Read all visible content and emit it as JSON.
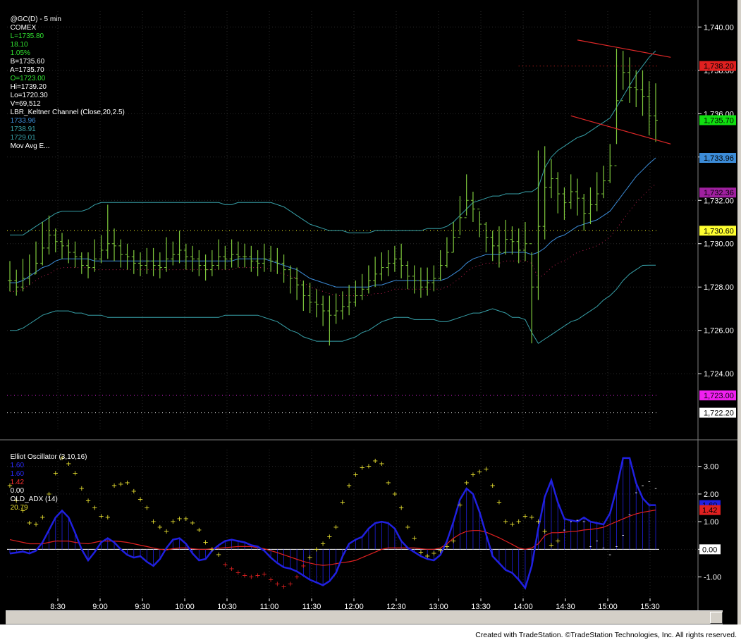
{
  "header": {
    "symbol": "@GC(D) - 5 min",
    "exchange": "COMEX",
    "last": "L=1735.80",
    "change": "18.10",
    "change_pct": "1.05%",
    "bid": "B=1735.60",
    "ask": "A=1735.70",
    "open": "O=1723.00",
    "high": "Hi=1739.20",
    "low": "Lo=1720.30",
    "volume": "V=69,512",
    "indicator": "LBR_Keltner Channel (Close,20,2.5)",
    "kc_mid": "1733.96",
    "kc_upper": "1738.91",
    "kc_lower": "1729.01",
    "mov_avg": "Mov Avg E..."
  },
  "osc_header": {
    "name": "Elliot Oscillator (3,10,16)",
    "v1": "1.60",
    "v2": "1.60",
    "v3": "1.42",
    "v4": "0.00",
    "adx_name": "OLD_ADX (14)",
    "adx_value": "20.79"
  },
  "footer": "Created with TradeStation. ©TradeStation Technologies, Inc. All rights reserved.",
  "colors": {
    "bar": "#7ec83c",
    "kc_band": "#37a0a8",
    "kc_mid": "#3c8cd8",
    "trend": "#e02828",
    "osc_line": "#2020e0",
    "osc_sig": "#e02020",
    "adx_dot": "#e8e030",
    "grid": "#2a2a2a"
  },
  "chart_data": [
    {
      "type": "candlestick",
      "title": "@GC(D) - 5 min",
      "x_ticks": [
        "8:30",
        "9:00",
        "9:30",
        "10:00",
        "10:30",
        "11:00",
        "11:30",
        "12:00",
        "12:30",
        "13:00",
        "13:30",
        "14:00",
        "14:30",
        "15:00",
        "15:30"
      ],
      "y_ticks": [
        "1,740.00",
        "1,738.00",
        "1,736.00",
        "1,734.00",
        "1,732.00",
        "1,730.00",
        "1,728.00",
        "1,726.00",
        "1,724.00"
      ],
      "ylim": [
        1721.6,
        1740.4
      ],
      "price_labels": [
        {
          "text": "1,738.20",
          "value": 1738.2,
          "bg": "#e02020",
          "fg": "#000000"
        },
        {
          "text": "1,735.70",
          "value": 1735.7,
          "bg": "#10e010",
          "fg": "#000000"
        },
        {
          "text": "1,733.96",
          "value": 1733.96,
          "bg": "#3c8cd8",
          "fg": "#000000"
        },
        {
          "text": "1,732.36",
          "value": 1732.36,
          "bg": "#a020a0",
          "fg": "#000000"
        },
        {
          "text": "1,730.60",
          "value": 1730.6,
          "bg": "#ffff30",
          "fg": "#000000"
        },
        {
          "text": "1,723.00",
          "value": 1723.0,
          "bg": "#f020f0",
          "fg": "#000000"
        },
        {
          "text": "1,722.20",
          "value": 1722.2,
          "bg": "#ffffff",
          "fg": "#000000"
        }
      ],
      "closes": [
        1728.3,
        1728.0,
        1728.4,
        1728.6,
        1729.1,
        1729.8,
        1730.4,
        1730.1,
        1729.9,
        1729.6,
        1729.4,
        1729.0,
        1728.9,
        1729.3,
        1729.7,
        1730.0,
        1729.9,
        1729.5,
        1729.4,
        1729.1,
        1729.0,
        1729.2,
        1729.0,
        1728.9,
        1729.3,
        1729.5,
        1729.7,
        1729.4,
        1729.3,
        1729.0,
        1728.8,
        1729.0,
        1729.4,
        1729.3,
        1729.5,
        1729.4,
        1729.4,
        1729.2,
        1729.1,
        1729.3,
        1729.2,
        1729.1,
        1728.8,
        1728.4,
        1728.1,
        1727.6,
        1727.3,
        1727.2,
        1726.9,
        1726.7,
        1726.9,
        1727.1,
        1727.3,
        1727.6,
        1727.9,
        1728.3,
        1728.6,
        1728.9,
        1729.1,
        1729.3,
        1729.0,
        1728.5,
        1728.3,
        1728.0,
        1728.2,
        1728.4,
        1729.0,
        1729.6,
        1730.3,
        1731.2,
        1732.0,
        1731.6,
        1730.9,
        1730.3,
        1729.9,
        1729.6,
        1730.2,
        1730.1,
        1729.7,
        1730.0,
        1728.0,
        1730.8,
        1732.6,
        1733.0,
        1732.3,
        1731.9,
        1732.4,
        1732.1,
        1731.4,
        1731.8,
        1732.3,
        1732.9,
        1733.6,
        1736.6,
        1737.9,
        1737.2,
        1737.1,
        1736.8,
        1735.9,
        1735.7
      ],
      "highs": [
        1729.2,
        1728.8,
        1729.3,
        1729.5,
        1730.1,
        1731.0,
        1731.3,
        1730.7,
        1730.5,
        1730.2,
        1730.1,
        1729.6,
        1729.6,
        1730.2,
        1730.4,
        1731.8,
        1730.7,
        1730.2,
        1730.0,
        1729.7,
        1729.6,
        1729.8,
        1729.8,
        1729.6,
        1730.3,
        1730.1,
        1730.6,
        1730.0,
        1729.9,
        1729.7,
        1729.5,
        1729.7,
        1730.2,
        1729.9,
        1730.2,
        1730.1,
        1730.0,
        1729.9,
        1729.7,
        1730.0,
        1729.9,
        1729.8,
        1729.5,
        1729.0,
        1728.9,
        1728.3,
        1728.2,
        1727.9,
        1727.6,
        1727.6,
        1727.7,
        1727.8,
        1728.1,
        1728.3,
        1728.6,
        1729.0,
        1729.4,
        1729.6,
        1729.7,
        1729.9,
        1730.0,
        1729.2,
        1729.0,
        1728.9,
        1728.9,
        1729.0,
        1729.7,
        1730.3,
        1731.0,
        1732.2,
        1733.2,
        1732.4,
        1731.5,
        1731.0,
        1730.6,
        1730.8,
        1731.1,
        1730.8,
        1730.7,
        1731.0,
        1729.6,
        1734.3,
        1734.5,
        1733.9,
        1733.3,
        1732.6,
        1733.2,
        1733.0,
        1732.3,
        1732.6,
        1733.3,
        1733.6,
        1734.6,
        1739.0,
        1738.9,
        1738.6,
        1738.0,
        1738.0,
        1737.5,
        1737.4
      ],
      "lows": [
        1727.8,
        1727.6,
        1727.8,
        1728.1,
        1728.6,
        1729.0,
        1729.5,
        1729.6,
        1729.3,
        1729.1,
        1728.9,
        1728.6,
        1728.4,
        1728.7,
        1729.1,
        1729.3,
        1729.2,
        1728.9,
        1728.8,
        1728.6,
        1728.5,
        1728.6,
        1728.5,
        1728.4,
        1728.7,
        1729.0,
        1729.1,
        1728.8,
        1728.7,
        1728.5,
        1728.3,
        1728.5,
        1728.8,
        1728.8,
        1728.9,
        1728.9,
        1728.9,
        1728.7,
        1728.5,
        1728.7,
        1728.7,
        1728.6,
        1728.2,
        1727.7,
        1727.4,
        1726.9,
        1726.8,
        1726.6,
        1726.2,
        1725.3,
        1726.3,
        1726.5,
        1726.7,
        1727.1,
        1727.4,
        1727.7,
        1728.0,
        1728.3,
        1728.5,
        1728.7,
        1728.4,
        1727.9,
        1727.7,
        1727.5,
        1727.6,
        1727.8,
        1728.3,
        1728.9,
        1729.6,
        1730.4,
        1731.3,
        1731.0,
        1730.3,
        1729.6,
        1729.2,
        1728.9,
        1729.5,
        1729.5,
        1729.1,
        1729.2,
        1725.4,
        1727.4,
        1730.2,
        1732.1,
        1731.4,
        1731.1,
        1731.6,
        1731.3,
        1730.6,
        1730.9,
        1731.5,
        1732.1,
        1732.8,
        1734.6,
        1737.1,
        1736.5,
        1736.3,
        1735.9,
        1735.0,
        1734.7
      ],
      "kc_mid_line": [
        1728.2,
        1728.2,
        1728.3,
        1728.5,
        1728.7,
        1728.9,
        1729.0,
        1729.2,
        1729.3,
        1729.3,
        1729.3,
        1729.3,
        1729.3,
        1729.2,
        1729.2,
        1729.2,
        1729.2,
        1729.2,
        1729.2,
        1729.2,
        1729.2,
        1729.2,
        1729.2,
        1729.2,
        1729.2,
        1729.2,
        1729.2,
        1729.2,
        1729.2,
        1729.2,
        1729.2,
        1729.2,
        1729.2,
        1729.2,
        1729.2,
        1729.3,
        1729.3,
        1729.3,
        1729.3,
        1729.3,
        1729.2,
        1729.1,
        1729.0,
        1728.9,
        1728.8,
        1728.6,
        1728.4,
        1728.3,
        1728.2,
        1728.1,
        1728.0,
        1728.0,
        1728.0,
        1728.0,
        1728.0,
        1728.0,
        1728.1,
        1728.1,
        1728.2,
        1728.3,
        1728.3,
        1728.3,
        1728.3,
        1728.3,
        1728.3,
        1728.3,
        1728.3,
        1728.4,
        1728.6,
        1728.8,
        1729.1,
        1729.3,
        1729.4,
        1729.5,
        1729.5,
        1729.5,
        1729.6,
        1729.6,
        1729.6,
        1729.6,
        1729.5,
        1729.6,
        1729.8,
        1730.1,
        1730.3,
        1730.4,
        1730.6,
        1730.8,
        1730.9,
        1731.0,
        1731.1,
        1731.3,
        1731.5,
        1731.9,
        1732.3,
        1732.7,
        1733.1,
        1733.4,
        1733.7,
        1733.96
      ],
      "kc_upper_line": [
        1730.4,
        1730.4,
        1730.4,
        1730.6,
        1730.8,
        1731.0,
        1731.2,
        1731.4,
        1731.5,
        1731.5,
        1731.5,
        1731.5,
        1731.6,
        1731.8,
        1731.9,
        1731.9,
        1731.9,
        1731.9,
        1731.9,
        1731.9,
        1731.9,
        1731.9,
        1731.9,
        1731.9,
        1731.9,
        1731.9,
        1731.9,
        1731.9,
        1731.9,
        1731.9,
        1731.9,
        1731.9,
        1731.9,
        1731.8,
        1731.8,
        1731.9,
        1731.9,
        1731.9,
        1731.9,
        1731.9,
        1731.9,
        1731.8,
        1731.7,
        1731.5,
        1731.3,
        1731.1,
        1730.9,
        1730.8,
        1730.7,
        1730.6,
        1730.6,
        1730.6,
        1730.5,
        1730.5,
        1730.5,
        1730.5,
        1730.6,
        1730.6,
        1730.6,
        1730.6,
        1730.6,
        1730.6,
        1730.6,
        1730.6,
        1730.7,
        1730.7,
        1730.7,
        1730.8,
        1731.0,
        1731.3,
        1731.6,
        1731.9,
        1732.0,
        1732.1,
        1732.2,
        1732.2,
        1732.3,
        1732.3,
        1732.3,
        1732.4,
        1732.4,
        1732.6,
        1733.5,
        1734.0,
        1734.3,
        1734.5,
        1734.7,
        1734.9,
        1735.0,
        1735.2,
        1735.4,
        1735.6,
        1735.8,
        1736.3,
        1736.8,
        1737.3,
        1737.8,
        1738.2,
        1738.6,
        1738.9
      ],
      "kc_lower_line": [
        1726.0,
        1726.0,
        1726.1,
        1726.3,
        1726.5,
        1726.7,
        1726.8,
        1726.9,
        1726.9,
        1726.9,
        1726.8,
        1726.8,
        1726.7,
        1726.7,
        1726.7,
        1726.6,
        1726.6,
        1726.6,
        1726.6,
        1726.6,
        1726.6,
        1726.6,
        1726.6,
        1726.6,
        1726.6,
        1726.6,
        1726.6,
        1726.6,
        1726.6,
        1726.6,
        1726.6,
        1726.6,
        1726.6,
        1726.7,
        1726.7,
        1726.7,
        1726.7,
        1726.7,
        1726.7,
        1726.6,
        1726.5,
        1726.4,
        1726.2,
        1726.0,
        1725.9,
        1725.7,
        1725.6,
        1725.5,
        1725.5,
        1725.5,
        1725.5,
        1725.5,
        1725.6,
        1725.7,
        1725.9,
        1726.0,
        1726.2,
        1726.4,
        1726.5,
        1726.6,
        1726.6,
        1726.6,
        1726.5,
        1726.5,
        1726.5,
        1726.5,
        1726.4,
        1726.4,
        1726.5,
        1726.6,
        1726.7,
        1726.8,
        1726.8,
        1726.9,
        1727.0,
        1726.9,
        1726.8,
        1726.6,
        1726.6,
        1726.5,
        1725.9,
        1725.4,
        1725.6,
        1725.8,
        1726.0,
        1726.2,
        1726.4,
        1726.5,
        1726.7,
        1726.9,
        1727.1,
        1727.4,
        1727.6,
        1727.9,
        1728.3,
        1728.6,
        1728.8,
        1729.0,
        1729.01,
        1729.01
      ],
      "lines": [
        {
          "from": [
            87,
            1739.4
          ],
          "to": [
            100,
            1738.6
          ],
          "color": "trend"
        },
        {
          "from": [
            86,
            1735.9
          ],
          "to": [
            100,
            1734.6
          ],
          "color": "trend"
        }
      ],
      "hlines": [
        {
          "value": 1730.6,
          "color": "#d8d820"
        },
        {
          "value": 1723.0,
          "color": "#d020d0"
        },
        {
          "value": 1722.2,
          "color": "#d0d0d0"
        },
        {
          "value": 1738.2,
          "color": "#c02020",
          "from": 78
        }
      ]
    },
    {
      "type": "line",
      "title": "Elliot Oscillator (3,10,16)",
      "y_ticks": [
        "3.00",
        "2.00",
        "1.00",
        "0.00",
        "-1.00"
      ],
      "ylim": [
        -1.7,
        3.4
      ],
      "value_labels": [
        {
          "text": "1.60",
          "value": 1.6,
          "bg": "#2020e0",
          "fg": "#000000"
        },
        {
          "text": "1.42",
          "value": 1.42,
          "bg": "#e02020",
          "fg": "#000000"
        },
        {
          "text": "0.00",
          "value": 0.0,
          "bg": "#ffffff",
          "fg": "#000000"
        }
      ],
      "oscillator": [
        -0.15,
        -0.12,
        -0.08,
        -0.15,
        -0.05,
        0.25,
        0.7,
        1.15,
        1.4,
        1.15,
        0.6,
        0.0,
        -0.4,
        -0.1,
        0.25,
        0.4,
        0.25,
        0.0,
        -0.2,
        -0.3,
        -0.25,
        -0.45,
        -0.6,
        -0.35,
        0.05,
        0.35,
        0.4,
        0.2,
        -0.15,
        -0.4,
        -0.35,
        -0.05,
        0.15,
        0.3,
        0.35,
        0.3,
        0.25,
        0.15,
        0.1,
        -0.05,
        -0.3,
        -0.5,
        -0.65,
        -0.7,
        -0.8,
        -0.95,
        -1.1,
        -1.2,
        -1.3,
        -1.15,
        -0.85,
        -0.25,
        0.2,
        0.35,
        0.45,
        0.75,
        0.95,
        1.0,
        0.95,
        0.75,
        0.3,
        0.05,
        -0.1,
        -0.25,
        -0.35,
        -0.4,
        -0.2,
        0.3,
        1.0,
        1.8,
        2.2,
        2.0,
        1.35,
        0.55,
        -0.25,
        -0.5,
        -0.75,
        -0.85,
        -1.1,
        -1.4,
        -0.6,
        0.75,
        1.9,
        2.5,
        1.7,
        1.1,
        1.05,
        1.0,
        1.15,
        1.0,
        0.95,
        0.9,
        1.3,
        2.2,
        3.3,
        3.3,
        2.4,
        1.85,
        1.6,
        1.6
      ],
      "signal": [
        0.35,
        0.3,
        0.25,
        0.2,
        0.2,
        0.2,
        0.25,
        0.3,
        0.3,
        0.3,
        0.25,
        0.22,
        0.2,
        0.25,
        0.3,
        0.3,
        0.3,
        0.28,
        0.25,
        0.2,
        0.15,
        0.1,
        0.05,
        0.0,
        -0.02,
        0.02,
        0.05,
        0.05,
        0.02,
        0.0,
        0.0,
        0.02,
        0.04,
        0.06,
        0.08,
        0.1,
        0.1,
        0.1,
        0.06,
        0.02,
        -0.05,
        -0.12,
        -0.2,
        -0.28,
        -0.36,
        -0.44,
        -0.5,
        -0.55,
        -0.58,
        -0.56,
        -0.52,
        -0.48,
        -0.45,
        -0.4,
        -0.3,
        -0.2,
        -0.1,
        0.0,
        0.05,
        0.05,
        0.05,
        0.05,
        0.05,
        0.02,
        0.0,
        0.0,
        0.05,
        0.2,
        0.4,
        0.55,
        0.65,
        0.68,
        0.68,
        0.62,
        0.52,
        0.42,
        0.3,
        0.18,
        0.05,
        0.0,
        0.05,
        0.2,
        0.5,
        0.6,
        0.6,
        0.62,
        0.64,
        0.66,
        0.7,
        0.72,
        0.75,
        0.8,
        0.9,
        1.0,
        1.1,
        1.2,
        1.28,
        1.34,
        1.38,
        1.42
      ],
      "adx_dots": [
        2.3,
        1.75,
        1.4,
        0.95,
        0.9,
        1.15,
        2.0,
        2.75,
        3.3,
        3.1,
        2.75,
        2.2,
        1.75,
        1.5,
        1.2,
        1.15,
        2.3,
        2.35,
        2.4,
        2.1,
        1.8,
        1.5,
        1.0,
        0.8,
        0.65,
        1.0,
        1.1,
        1.1,
        0.95,
        0.7,
        0.25,
        0.0,
        -0.2,
        -0.55,
        -0.7,
        -0.85,
        -0.95,
        -1.0,
        -0.95,
        -0.9,
        -1.1,
        -1.25,
        -1.35,
        -1.25,
        -1.0,
        -0.6,
        -0.3,
        0.0,
        0.2,
        0.45,
        0.8,
        1.7,
        2.3,
        2.7,
        2.95,
        3.0,
        3.2,
        3.1,
        2.4,
        2.0,
        1.5,
        0.8,
        0.4,
        -0.1,
        -0.25,
        -0.15,
        -0.05,
        0.1,
        0.3,
        1.6,
        2.4,
        2.7,
        2.8,
        2.9,
        2.3,
        1.7,
        1.0,
        0.9,
        1.0,
        1.2,
        1.15,
        1.0,
        0.65,
        0.15,
        0.3,
        0.7,
        1.0,
        1.05,
        1.0,
        0.1,
        0.3,
        0.05,
        -0.2,
        0.1,
        0.5,
        1.25,
        2.05,
        2.3,
        2.45,
        2.2
      ]
    }
  ]
}
